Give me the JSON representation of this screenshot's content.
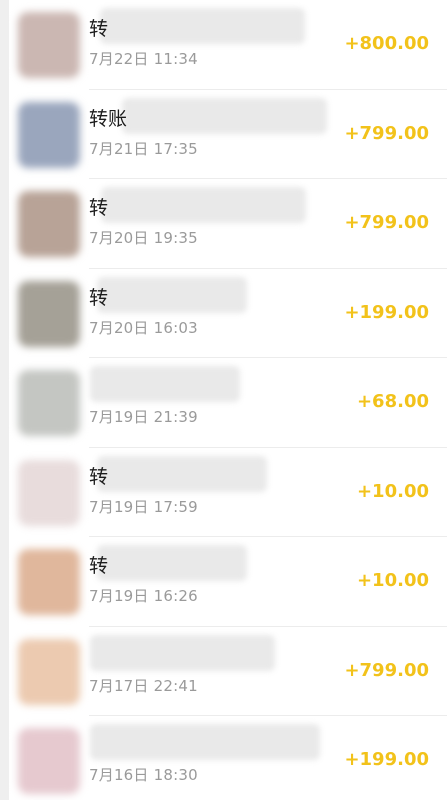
{
  "colors": {
    "amount": "#f2c21a",
    "title": "#1c1c1c",
    "time": "#9a9a9a",
    "divider": "#ececec"
  },
  "transactions": [
    {
      "title": "转",
      "time": "7月22日 11:34",
      "amount": "+800.00",
      "avatar_color": "#cbb7b2"
    },
    {
      "title": "转账",
      "time": "7月21日 17:35",
      "amount": "+799.00",
      "avatar_color": "#9aa6bd"
    },
    {
      "title": "转",
      "time": "7月20日 19:35",
      "amount": "+799.00",
      "avatar_color": "#b8a397"
    },
    {
      "title": "转",
      "time": "7月20日 16:03",
      "amount": "+199.00",
      "avatar_color": "#a5a197"
    },
    {
      "title": "",
      "time": "7月19日 21:39",
      "amount": "+68.00",
      "avatar_color": "#c4c6c2"
    },
    {
      "title": "转",
      "time": "7月19日 17:59",
      "amount": "+10.00",
      "avatar_color": "#e8dcdc"
    },
    {
      "title": "转",
      "time": "7月19日 16:26",
      "amount": "+10.00",
      "avatar_color": "#e0b79c"
    },
    {
      "title": "",
      "time": "7月17日 22:41",
      "amount": "+799.00",
      "avatar_color": "#eccab0"
    },
    {
      "title": "",
      "time": "7月16日 18:30",
      "amount": "+199.00",
      "avatar_color": "#e6c9cf"
    }
  ]
}
